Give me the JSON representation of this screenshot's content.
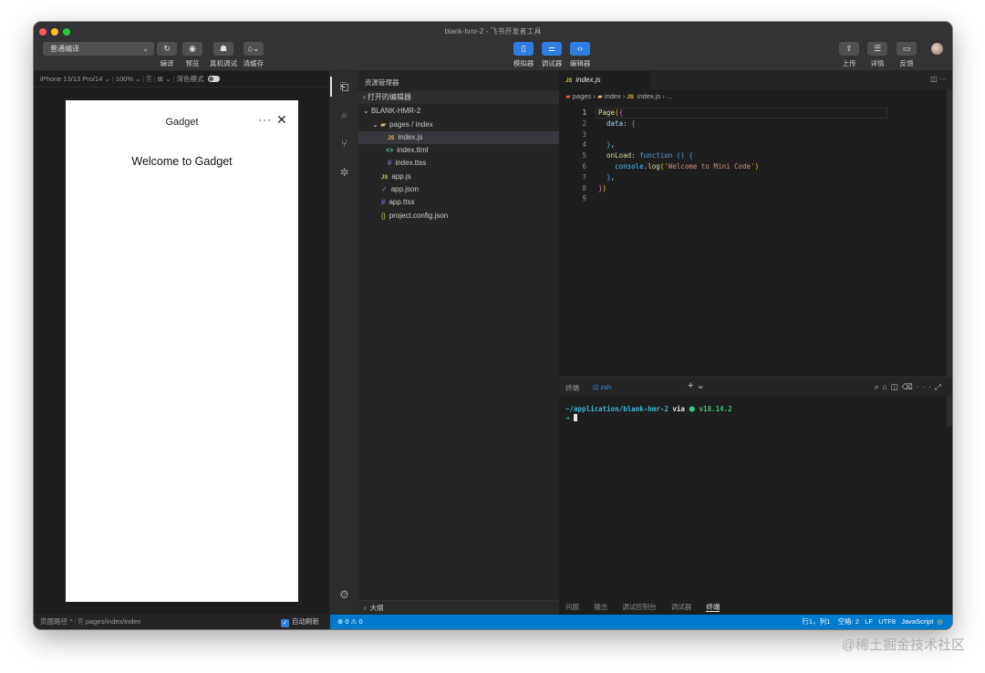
{
  "window": {
    "title": "blank-hmr-2 - 飞书开发者工具"
  },
  "toolbar": {
    "compile_mode": "普通编译",
    "buttons": [
      {
        "label": "编译",
        "icon": "refresh-icon"
      },
      {
        "label": "预览",
        "icon": "eye-icon"
      },
      {
        "label": "真机调试",
        "icon": "bug-icon"
      },
      {
        "label": "清缓存",
        "icon": "broom-icon"
      }
    ],
    "views": [
      {
        "label": "模拟器",
        "icon": "phone-icon"
      },
      {
        "label": "调试器",
        "icon": "sliders-icon"
      },
      {
        "label": "编辑器",
        "icon": "code-icon"
      }
    ],
    "right": [
      {
        "label": "上传",
        "icon": "upload-icon"
      },
      {
        "label": "详情",
        "icon": "menu-icon"
      },
      {
        "label": "反馈",
        "icon": "feedback-icon"
      }
    ]
  },
  "simulator": {
    "device": "iPhone 13/13 Pro/14",
    "zoom": "100%",
    "dark_mode_label": "深色模式",
    "phone": {
      "nav_title": "Gadget",
      "more": "···",
      "close": "✕",
      "welcome": "Welcome to Gadget"
    }
  },
  "explorer": {
    "title": "资源管理器",
    "open_editors": "打开的编辑器",
    "project": "BLANK-HMR-2",
    "folder": "pages / index",
    "files": [
      {
        "name": "index.js",
        "badge": "JS",
        "kind": "js"
      },
      {
        "name": "index.ttml",
        "badge": "<>",
        "kind": "ttml"
      },
      {
        "name": "index.ttss",
        "badge": "#",
        "kind": "ttss"
      },
      {
        "name": "app.js",
        "badge": "JS",
        "kind": "js"
      },
      {
        "name": "app.json",
        "badge": "✓",
        "kind": "json"
      },
      {
        "name": "app.ttss",
        "badge": "#",
        "kind": "ttss"
      },
      {
        "name": "project.config.json",
        "badge": "{}",
        "kind": "cfg"
      }
    ],
    "outline": "大纲"
  },
  "editor": {
    "tab": "index.js",
    "tab_badge": "JS",
    "breadcrumb": {
      "pages": "pages",
      "index": "index",
      "file": "index.js",
      "ellipsis": "..."
    },
    "line_numbers": [
      "1",
      "2",
      "3",
      "4",
      "5",
      "6",
      "7",
      "8",
      "9"
    ]
  },
  "terminal": {
    "label": "终端",
    "tab": "zsh",
    "prompt_path": "~/application/blank-hmr-2",
    "via": "via",
    "node": "⬢ v18.14.2",
    "arrow": "➜"
  },
  "panel_tabs": [
    "问题",
    "输出",
    "调试控制台",
    "调试器",
    "终端"
  ],
  "status": {
    "page_path_label": "页面路径",
    "page_path": "pages/index/index",
    "auto_refresh": "自动刷新",
    "errors": "⊗ 0",
    "warnings": "⚠ 0",
    "cursor": "行1，列1",
    "spaces": "空格: 2",
    "eol": "LF",
    "encoding": "UTF8",
    "language": "JavaScript"
  },
  "watermark": "@稀土掘金技术社区",
  "colors": {
    "accent": "#2f7de1",
    "statusbar": "#007acc",
    "editor_bg": "#1e1e1e"
  }
}
